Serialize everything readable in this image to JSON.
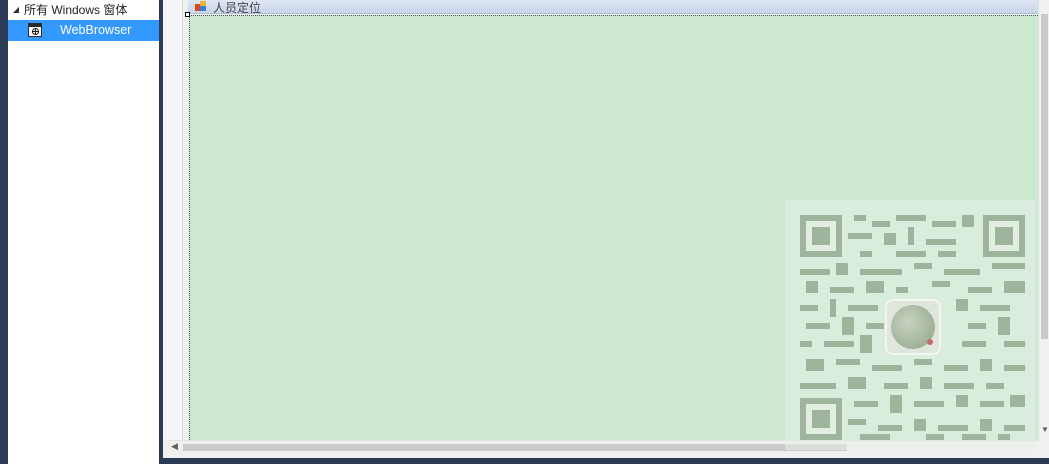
{
  "toolbox": {
    "group_label": "所有 Windows 窗体",
    "group_arrow": "◢",
    "selected_item": "WebBrowser"
  },
  "designer": {
    "form_title": "人员定位",
    "form_background": "#cde8d0"
  },
  "scrollbars": {
    "left_arrow": "◀",
    "down_arrow": "▼"
  },
  "colors": {
    "selection": "#3399ff",
    "frame": "#2b3a55"
  }
}
